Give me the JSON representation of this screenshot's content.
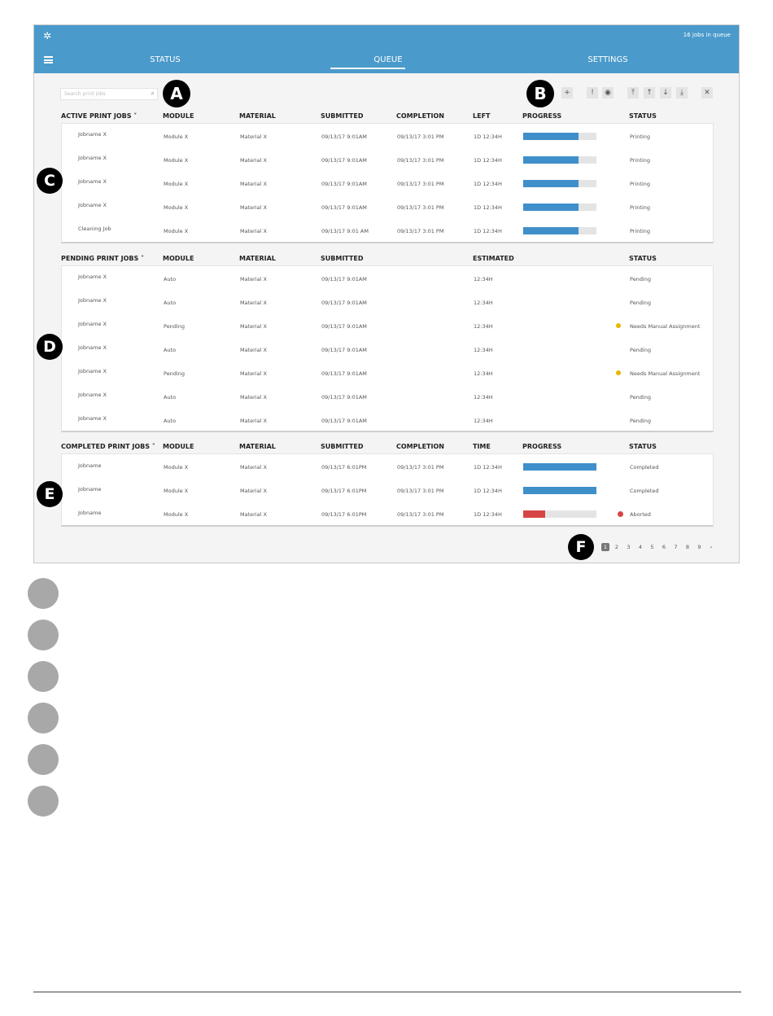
{
  "header": {
    "logo": "✲",
    "jobs_count": "16 jobs in queue"
  },
  "nav": {
    "status": "STATUS",
    "queue": "QUEUE",
    "settings": "SETTINGS"
  },
  "search": {
    "placeholder": "Search print jobs"
  },
  "markers": {
    "a": "A",
    "b": "B",
    "c": "C",
    "d": "D",
    "e": "E",
    "f": "F"
  },
  "toolbar": {
    "add": "+",
    "info": "!",
    "eye": "◉",
    "top": "⤒",
    "up": "↑",
    "down": "↓",
    "bottom": "⤓",
    "close": "✕"
  },
  "active": {
    "headers": {
      "name": "ACTIVE PRINT JOBS ˅",
      "module": "MODULE",
      "material": "MATERIAL",
      "submitted": "SUBMITTED",
      "completion": "COMPLETION",
      "left": "LEFT",
      "progress": "PROGRESS",
      "status": "STATUS"
    },
    "rows": [
      {
        "name": "Jobname X",
        "module": "Module X",
        "material": "Material X",
        "submitted": "09/13/17 9:01AM",
        "completion": "09/13/17 3:01 PM",
        "left": "1D 12:34H",
        "progress": 75.1,
        "progress_label": "75.1%",
        "status": "Printing"
      },
      {
        "name": "Jobname X",
        "module": "Module X",
        "material": "Material X",
        "submitted": "09/13/17 9:01AM",
        "completion": "09/13/17 3:01 PM",
        "left": "1D 12:34H",
        "progress": 75.1,
        "progress_label": "75.1%",
        "status": "Printing"
      },
      {
        "name": "Jobname X",
        "module": "Module X",
        "material": "Material X",
        "submitted": "09/13/17 9:01AM",
        "completion": "09/13/17 3:01 PM",
        "left": "1D 12:34H",
        "progress": 75.1,
        "progress_label": "75.1%",
        "status": "Printing"
      },
      {
        "name": "Jobname X",
        "module": "Module X",
        "material": "Material X",
        "submitted": "09/13/17 9:01AM",
        "completion": "09/13/17 3:01 PM",
        "left": "1D 12:34H",
        "progress": 75.1,
        "progress_label": "75.1%",
        "status": "Printing"
      },
      {
        "name": "Cleaning Job",
        "module": "Module X",
        "material": "Material X",
        "submitted": "09/13/17 9:01 AM",
        "completion": "09/13/17 3:01 PM",
        "left": "1D 12:34H",
        "progress": 75,
        "progress_label": "75%",
        "status": "Printing"
      }
    ]
  },
  "pending": {
    "headers": {
      "name": "PENDING PRINT JOBS ˅",
      "module": "MODULE",
      "material": "MATERIAL",
      "submitted": "SUBMITTED",
      "estimated": "ESTIMATED",
      "status": "STATUS"
    },
    "rows": [
      {
        "name": "Jobname X",
        "module": "Auto",
        "material": "Material X",
        "submitted": "09/13/17 9:01AM",
        "estimated": "12:34H",
        "status": "Pending",
        "warn": false
      },
      {
        "name": "Jobname X",
        "module": "Auto",
        "material": "Material X",
        "submitted": "09/13/17 9:01AM",
        "estimated": "12:34H",
        "status": "Pending",
        "warn": false
      },
      {
        "name": "Jobname X",
        "module": "Pending",
        "material": "Material X",
        "submitted": "09/13/17 9:01AM",
        "estimated": "12:34H",
        "status": "Needs Manual Assignment",
        "warn": true
      },
      {
        "name": "Jobname X",
        "module": "Auto",
        "material": "Material X",
        "submitted": "09/13/17 9:01AM",
        "estimated": "12:34H",
        "status": "Pending",
        "warn": false
      },
      {
        "name": "Jobname X",
        "module": "Pending",
        "material": "Material X",
        "submitted": "09/13/17 9:01AM",
        "estimated": "12:34H",
        "status": "Needs Manual Assignment",
        "warn": true
      },
      {
        "name": "Jobname X",
        "module": "Auto",
        "material": "Material X",
        "submitted": "09/13/17 9:01AM",
        "estimated": "12:34H",
        "status": "Pending",
        "warn": false
      },
      {
        "name": "Jobname X",
        "module": "Auto",
        "material": "Material X",
        "submitted": "09/13/17 9:01AM",
        "estimated": "12:34H",
        "status": "Pending",
        "warn": false
      }
    ]
  },
  "completed": {
    "headers": {
      "name": "COMPLETED PRINT JOBS ˅",
      "module": "MODULE",
      "material": "MATERIAL",
      "submitted": "SUBMITTED",
      "completion": "COMPLETION",
      "time": "TIME",
      "progress": "PROGRESS",
      "status": "STATUS"
    },
    "rows": [
      {
        "name": "Jobname",
        "module": "Module X",
        "material": "Material X",
        "submitted": "09/13/17 6:01PM",
        "completion": "09/13/17 3:01 PM",
        "time": "1D 12:34H",
        "progress": 100,
        "progress_label": "100%",
        "status": "Completed",
        "error": false
      },
      {
        "name": "Jobname",
        "module": "Module X",
        "material": "Material X",
        "submitted": "09/13/17 6:01PM",
        "completion": "09/13/17 3:01 PM",
        "time": "1D 12:34H",
        "progress": 100,
        "progress_label": "100%",
        "status": "Completed",
        "error": false
      },
      {
        "name": "Jobname",
        "module": "Module X",
        "material": "Material X",
        "submitted": "09/13/17 6:01PM",
        "completion": "09/13/17 3:01 PM",
        "time": "1D 12:34H",
        "progress": 30,
        "progress_label": "30%",
        "status": "Aborted",
        "error": true
      }
    ]
  },
  "pagination": {
    "current": "1",
    "pages": [
      "2",
      "3",
      "4",
      "5",
      "6",
      "7",
      "8",
      "9"
    ],
    "next": "›"
  },
  "colors": {
    "accent": "#4a9acb",
    "progress": "#3f8fca",
    "error": "#d64545",
    "warning": "#e6b800"
  }
}
